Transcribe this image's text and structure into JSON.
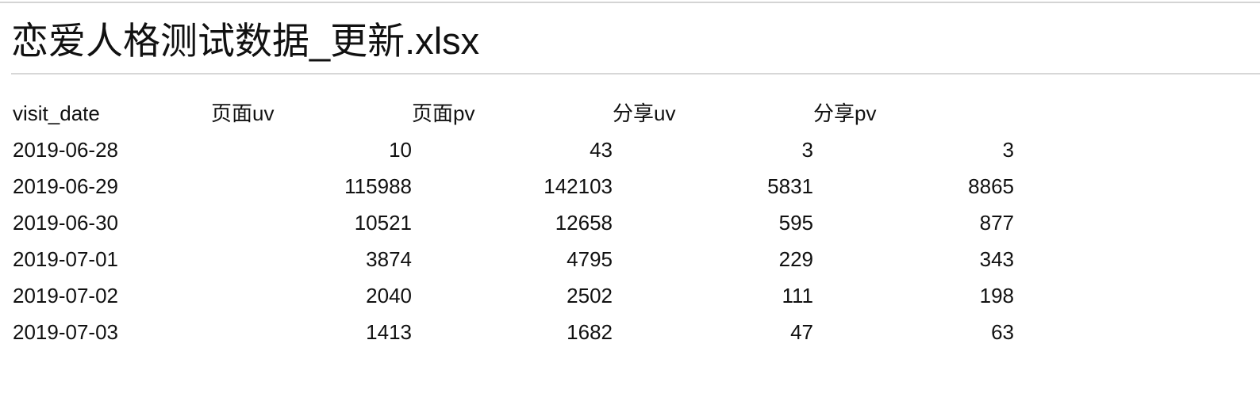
{
  "document": {
    "title": "恋爱人格测试数据_更新.xlsx"
  },
  "table": {
    "headers": [
      "visit_date",
      "页面uv",
      "页面pv",
      "分享uv",
      "分享pv"
    ],
    "rows": [
      [
        "2019-06-28",
        "10",
        "43",
        "3",
        "3"
      ],
      [
        "2019-06-29",
        "115988",
        "142103",
        "5831",
        "8865"
      ],
      [
        "2019-06-30",
        "10521",
        "12658",
        "595",
        "877"
      ],
      [
        "2019-07-01",
        "3874",
        "4795",
        "229",
        "343"
      ],
      [
        "2019-07-02",
        "2040",
        "2502",
        "111",
        "198"
      ],
      [
        "2019-07-03",
        "1413",
        "1682",
        "47",
        "63"
      ]
    ]
  }
}
